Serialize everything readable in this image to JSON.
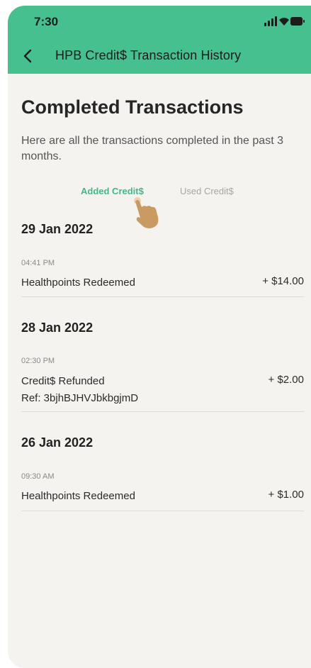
{
  "status": {
    "time": "7:30"
  },
  "nav": {
    "title": "HPB Credit$ Transaction History"
  },
  "page": {
    "title": "Completed Transactions",
    "subtitle": "Here are all the transactions completed in the past 3 months."
  },
  "tabs": [
    {
      "label": "Added Credit$",
      "active": true
    },
    {
      "label": "Used Credit$",
      "active": false
    }
  ],
  "groups": [
    {
      "date": "29 Jan 2022",
      "transactions": [
        {
          "time": "04:41 PM",
          "description": "Healthpoints Redeemed",
          "amount": "+ $14.00"
        }
      ]
    },
    {
      "date": "28 Jan 2022",
      "transactions": [
        {
          "time": "02:30 PM",
          "description": "Credit$ Refunded",
          "ref": "Ref: 3bjhBJHVJbkbgjmD",
          "amount": "+ $2.00"
        }
      ]
    },
    {
      "date": "26 Jan 2022",
      "transactions": [
        {
          "time": "09:30 AM",
          "description": "Healthpoints Redeemed",
          "amount": "+ $1.00"
        }
      ]
    }
  ],
  "colors": {
    "accent": "#47c08f",
    "active_tab": "#3fba87",
    "background": "#f4f3ef"
  },
  "icons": [
    "signal-icon",
    "wifi-icon",
    "battery-icon",
    "chevron-left-icon",
    "hand-pointer-icon"
  ]
}
